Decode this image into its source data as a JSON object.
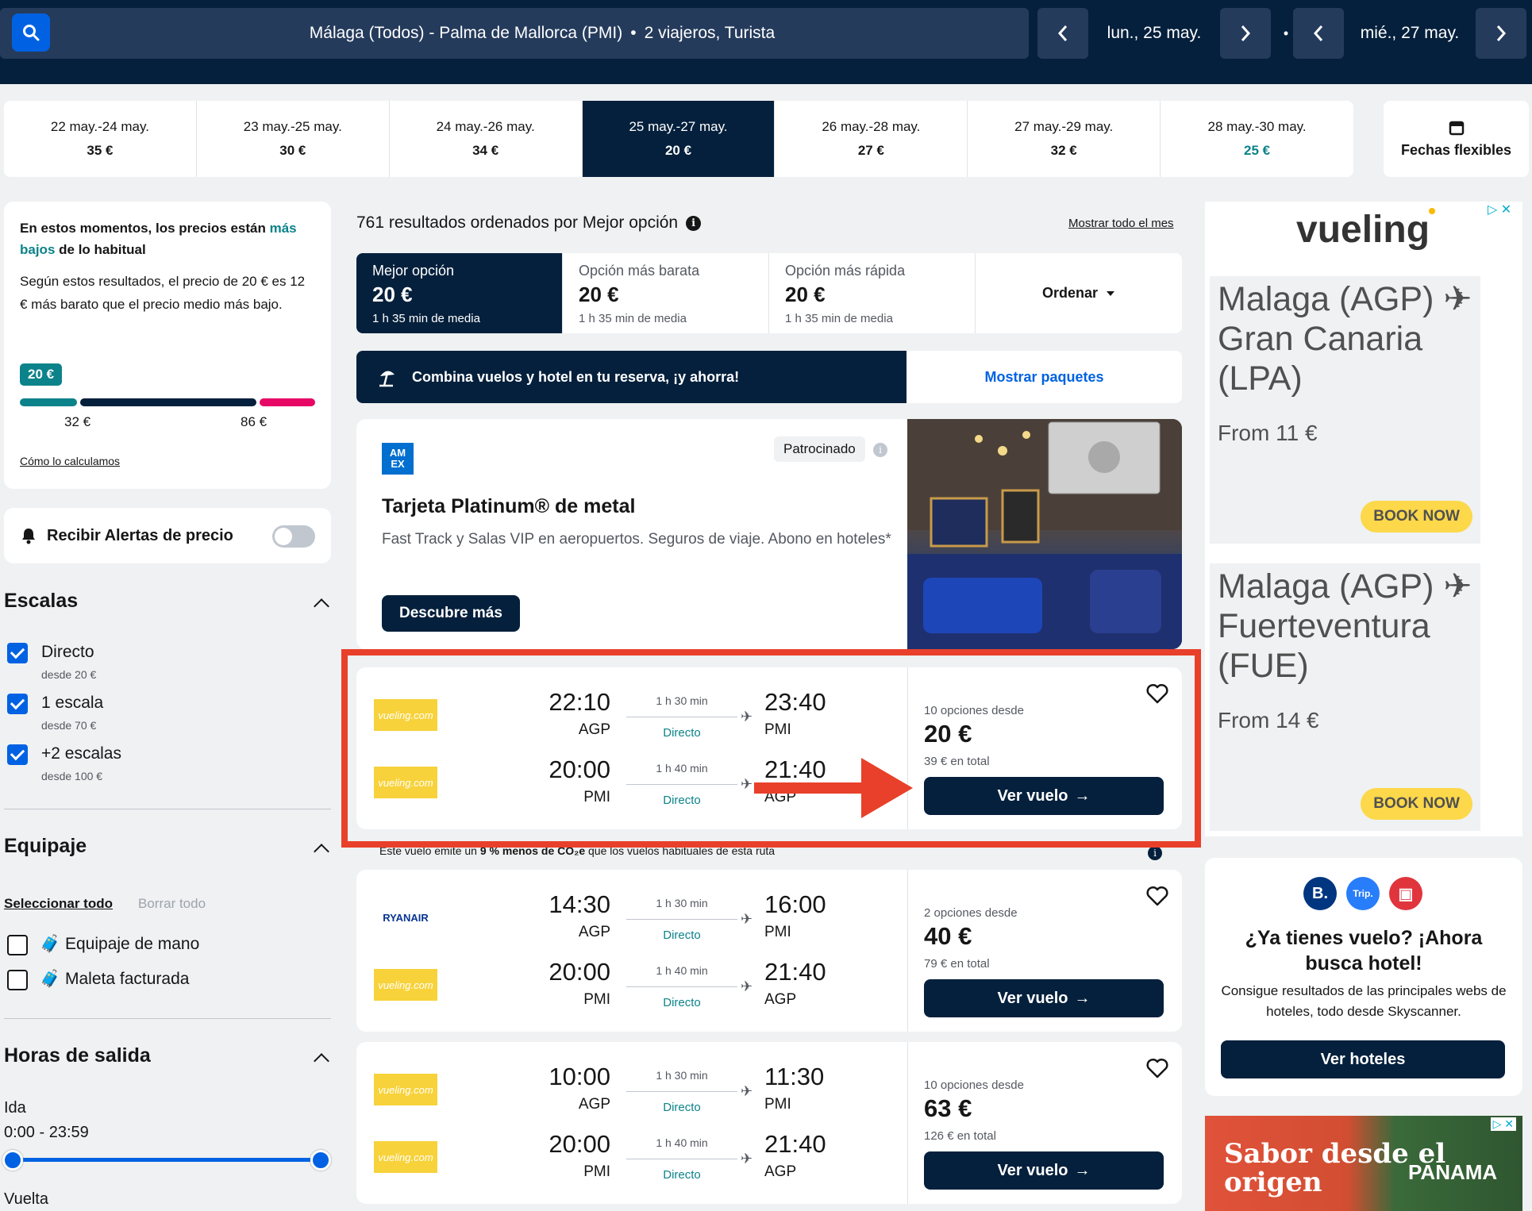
{
  "search": {
    "route": "Málaga (Todos) - Palma de Mallorca (PMI)",
    "separator": "•",
    "travellers": "2 viajeros, Turista",
    "depart_date": "lun., 25 may.",
    "return_date": "mié., 27 may.",
    "date_separator": "•"
  },
  "date_strip": [
    {
      "range": "22 may.-24 may.",
      "price": "35 €"
    },
    {
      "range": "23 may.-25 may.",
      "price": "30 €"
    },
    {
      "range": "24 may.-26 may.",
      "price": "34 €"
    },
    {
      "range": "25 may.-27 may.",
      "price": "20 €",
      "selected": true
    },
    {
      "range": "26 may.-28 may.",
      "price": "27 €"
    },
    {
      "range": "27 may.-29 may.",
      "price": "32 €"
    },
    {
      "range": "28 may.-30 may.",
      "price": "25 €",
      "lowest": true
    }
  ],
  "flexible_dates": "Fechas flexibles",
  "price_insight": {
    "head_1": "En estos momentos, los precios están ",
    "head_hl_1": "más",
    "head_hl_2": "bajos",
    "head_2": " de lo habitual",
    "body": "Según estos resultados, el precio de 20 € es 12 € más barato que el precio medio más bajo.",
    "badge": "20 €",
    "low_label": "32 €",
    "high_label": "86 €",
    "how_link": "Cómo lo calculamos"
  },
  "alerts": {
    "label": "Recibir Alertas de precio",
    "enabled": false
  },
  "filters": {
    "stops": {
      "title": "Escalas",
      "options": [
        {
          "label": "Directo",
          "sub": "desde 20 €",
          "checked": true
        },
        {
          "label": "1 escala",
          "sub": "desde 70 €",
          "checked": true
        },
        {
          "label": "+2 escalas",
          "sub": "desde 100 €",
          "checked": true
        }
      ]
    },
    "baggage": {
      "title": "Equipaje",
      "select_all": "Seleccionar todo",
      "clear_all": "Borrar todo",
      "options": [
        {
          "label": "Equipaje de mano",
          "checked": false
        },
        {
          "label": "Maleta facturada",
          "checked": false
        }
      ]
    },
    "departure": {
      "title": "Horas de salida",
      "outbound_label": "Ida",
      "outbound_range": "0:00 - 23:59",
      "return_label": "Vuelta"
    }
  },
  "results": {
    "count_text": "761 resultados ordenados por Mejor opción",
    "month_link": "Mostrar todo el mes",
    "sort_tabs": [
      {
        "label": "Mejor opción",
        "price": "20 €",
        "time": "1 h 35 min de media",
        "active": true
      },
      {
        "label": "Opción más barata",
        "price": "20 €",
        "time": "1 h 35 min de media"
      },
      {
        "label": "Opción más rápida",
        "price": "20 €",
        "time": "1 h 35 min de media"
      }
    ],
    "sort_button": "Ordenar"
  },
  "combo": {
    "text": "Combina vuelos y hotel en tu reserva, ¡y ahorra!",
    "link": "Mostrar paquetes"
  },
  "amex_ad": {
    "logo": "AM EX",
    "sponsored": "Patrocinado",
    "title": "Tarjeta Platinum® de metal",
    "desc": "Fast Track y Salas VIP en aeropuertos. Seguros de viaje. Abono en hoteles*",
    "cta": "Descubre más"
  },
  "flights": [
    {
      "legs": [
        {
          "airline": "vueling.com",
          "dep_time": "22:10",
          "dep_airport": "AGP",
          "duration": "1 h 30 min",
          "stops": "Directo",
          "arr_time": "23:40",
          "arr_airport": "PMI"
        },
        {
          "airline": "vueling.com",
          "dep_time": "20:00",
          "dep_airport": "PMI",
          "duration": "1 h 40 min",
          "stops": "Directo",
          "arr_time": "21:40",
          "arr_airport": "AGP"
        }
      ],
      "options": "10 opciones desde",
      "price": "20 €",
      "total": "39 € en total",
      "cta": "Ver vuelo"
    },
    {
      "legs": [
        {
          "airline": "RYANAIR",
          "dep_time": "14:30",
          "dep_airport": "AGP",
          "duration": "1 h 30 min",
          "stops": "Directo",
          "arr_time": "16:00",
          "arr_airport": "PMI"
        },
        {
          "airline": "vueling.com",
          "dep_time": "20:00",
          "dep_airport": "PMI",
          "duration": "1 h 40 min",
          "stops": "Directo",
          "arr_time": "21:40",
          "arr_airport": "AGP"
        }
      ],
      "options": "2 opciones desde",
      "price": "40 €",
      "total": "79 € en total",
      "cta": "Ver vuelo"
    },
    {
      "legs": [
        {
          "airline": "vueling.com",
          "dep_time": "10:00",
          "dep_airport": "AGP",
          "duration": "1 h 30 min",
          "stops": "Directo",
          "arr_time": "11:30",
          "arr_airport": "PMI"
        },
        {
          "airline": "vueling.com",
          "dep_time": "20:00",
          "dep_airport": "PMI",
          "duration": "1 h 40 min",
          "stops": "Directo",
          "arr_time": "21:40",
          "arr_airport": "AGP"
        }
      ],
      "options": "10 opciones desde",
      "price": "63 €",
      "total": "126 € en total",
      "cta": "Ver vuelo"
    }
  ],
  "co2_note": {
    "pre": "Este vuelo emite un ",
    "bold": "9 % menos de CO₂e",
    "post": " que los vuelos habituales de esta ruta"
  },
  "vueling_ad": {
    "logo": "vueling",
    "offers": [
      {
        "route": "Malaga (AGP) ✈ Gran Canaria (LPA)",
        "from": "From 11 €",
        "cta": "BOOK NOW"
      },
      {
        "route": "Malaga (AGP) ✈ Fuerteventura (FUE)",
        "from": "From 14 €",
        "cta": "BOOK NOW"
      }
    ]
  },
  "hotel_promo": {
    "logos": [
      "B.",
      "Trip.",
      "▣"
    ],
    "title": "¿Ya tienes vuelo? ¡Ahora busca hotel!",
    "sub": "Consigue resultados de las principales webs de hoteles, todo desde Skyscanner.",
    "cta": "Ver hoteles"
  },
  "panama_ad": {
    "title": "Sabor desde el origen",
    "brand": "PANAMA"
  },
  "colors": {
    "navy": "#05203c",
    "blue": "#0062e3",
    "teal": "#0c838a",
    "highlight": "#e8402a"
  }
}
